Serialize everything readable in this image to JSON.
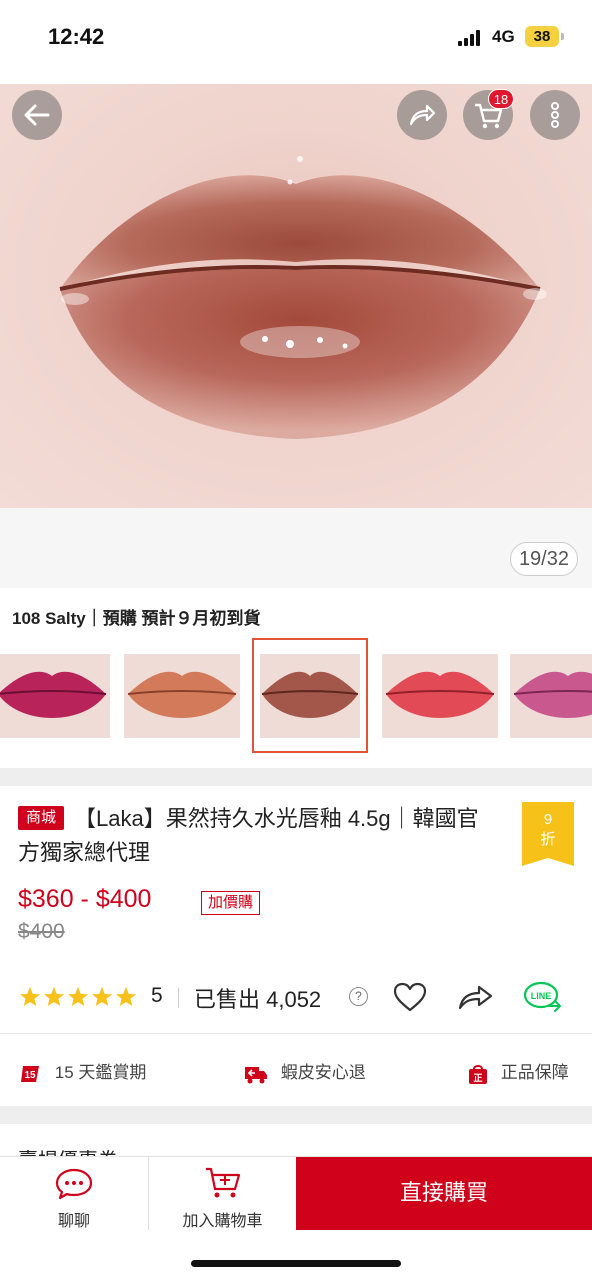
{
  "status_bar": {
    "time": "12:42",
    "network": "4G",
    "battery": "38"
  },
  "hero": {
    "cart_count": "18",
    "image_counter": "19/32"
  },
  "variant": {
    "title": "108 Salty｜預購 預計９月初到貨"
  },
  "product": {
    "mall_tag": "商城",
    "title": "【Laka】果然持久水光唇釉 4.5g｜韓國官方獨家總代理",
    "discount_num": "9",
    "discount_unit": "折",
    "price_range": "$360 - $400",
    "addon_tag": "加價購",
    "original_price": "$400",
    "rating": "5",
    "sold": "已售出 4,052",
    "help_mark": "?"
  },
  "guarantees": [
    {
      "label": "15 天鑑賞期",
      "icon": "fifteen-days-icon"
    },
    {
      "label": "蝦皮安心退",
      "icon": "return-truck-icon"
    },
    {
      "label": "正品保障",
      "icon": "authentic-bag-icon"
    }
  ],
  "promo": {
    "label": "賣場優惠券"
  },
  "bottom_bar": {
    "chat_label": "聊聊",
    "cart_label": "加入購物車",
    "buy_label": "直接購買"
  },
  "colors": {
    "brand_red": "#d0011b",
    "star": "#f6c21a",
    "badge_yellow": "#f6c21a",
    "line_green": "#06c755"
  }
}
